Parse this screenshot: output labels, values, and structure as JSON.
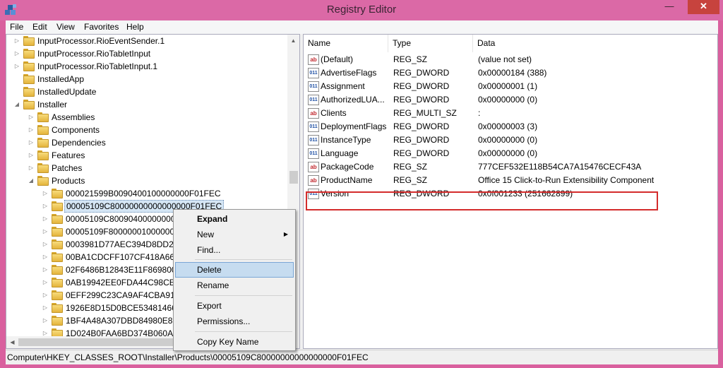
{
  "window": {
    "title": "Registry Editor",
    "minimize": "—",
    "maximize": "▢",
    "close": "✕"
  },
  "menu": [
    "File",
    "Edit",
    "View",
    "Favorites",
    "Help"
  ],
  "tree": [
    {
      "label": "InputProcessor.RioEventSender.1",
      "expanded": false
    },
    {
      "label": "InputProcessor.RioTabletInput",
      "expanded": false
    },
    {
      "label": "InputProcessor.RioTabletInput.1",
      "expanded": false
    },
    {
      "label": "InstalledApp",
      "expanded": null
    },
    {
      "label": "InstalledUpdate",
      "expanded": null
    },
    {
      "label": "Installer",
      "expanded": true
    },
    {
      "label": "Assemblies",
      "expanded": false
    },
    {
      "label": "Components",
      "expanded": false
    },
    {
      "label": "Dependencies",
      "expanded": false
    },
    {
      "label": "Features",
      "expanded": false
    },
    {
      "label": "Patches",
      "expanded": false
    },
    {
      "label": "Products",
      "expanded": true
    },
    {
      "label": "000021599B0090400100000000F01FEC",
      "expanded": false
    },
    {
      "label": "00005109C80000000000000000F01FEC",
      "expanded": false,
      "selected": true
    },
    {
      "label": "00005109C800904000000000",
      "expanded": false
    },
    {
      "label": "00005109F800000010000000",
      "expanded": false
    },
    {
      "label": "0003981D77AEC394D8DD2E2",
      "expanded": false
    },
    {
      "label": "00BA1CDCFF107CF418A6616",
      "expanded": false
    },
    {
      "label": "02F6486B12843E11F869800",
      "expanded": false
    },
    {
      "label": "0AB19942EE0FDA44C98CE55",
      "expanded": false
    },
    {
      "label": "0EFF299C23CA9AF4CBA91F3",
      "expanded": false
    },
    {
      "label": "1926E8D15D0BCE5348146661",
      "expanded": false
    },
    {
      "label": "1BF4A48A307DBD84980E866E",
      "expanded": false
    },
    {
      "label": "1D024B0FAA6BD374B060AA",
      "expanded": false
    }
  ],
  "columns": {
    "name": "Name",
    "type": "Type",
    "data": "Data"
  },
  "values": [
    {
      "icon": "ab",
      "name": "(Default)",
      "type": "REG_SZ",
      "data": "(value not set)"
    },
    {
      "icon": "bin",
      "name": "AdvertiseFlags",
      "type": "REG_DWORD",
      "data": "0x00000184 (388)"
    },
    {
      "icon": "bin",
      "name": "Assignment",
      "type": "REG_DWORD",
      "data": "0x00000001 (1)"
    },
    {
      "icon": "bin",
      "name": "AuthorizedLUA...",
      "type": "REG_DWORD",
      "data": "0x00000000 (0)"
    },
    {
      "icon": "ab",
      "name": "Clients",
      "type": "REG_MULTI_SZ",
      "data": ":"
    },
    {
      "icon": "bin",
      "name": "DeploymentFlags",
      "type": "REG_DWORD",
      "data": "0x00000003 (3)"
    },
    {
      "icon": "bin",
      "name": "InstanceType",
      "type": "REG_DWORD",
      "data": "0x00000000 (0)"
    },
    {
      "icon": "bin",
      "name": "Language",
      "type": "REG_DWORD",
      "data": "0x00000000 (0)"
    },
    {
      "icon": "ab",
      "name": "PackageCode",
      "type": "REG_SZ",
      "data": "777CEF532E118B54CA7A15476CECF43A"
    },
    {
      "icon": "ab",
      "name": "ProductName",
      "type": "REG_SZ",
      "data": "Office 15 Click-to-Run Extensibility Component"
    },
    {
      "icon": "bin",
      "name": "Version",
      "type": "REG_DWORD",
      "data": "0x0f001233 (251662899)"
    }
  ],
  "icon_glyphs": {
    "ab": "ab",
    "bin": "011\n110"
  },
  "context_menu": {
    "expand": "Expand",
    "new": "New",
    "find": "Find...",
    "delete": "Delete",
    "rename": "Rename",
    "export": "Export",
    "permissions": "Permissions...",
    "copy_key_name": "Copy Key Name"
  },
  "status": "Computer\\HKEY_CLASSES_ROOT\\Installer\\Products\\00005109C80000000000000000F01FEC",
  "colors": {
    "title_bar": "#db69a6",
    "close_button": "#c7433e",
    "highlight_box": "#d42c2c",
    "selection": "#d5e6f5"
  }
}
